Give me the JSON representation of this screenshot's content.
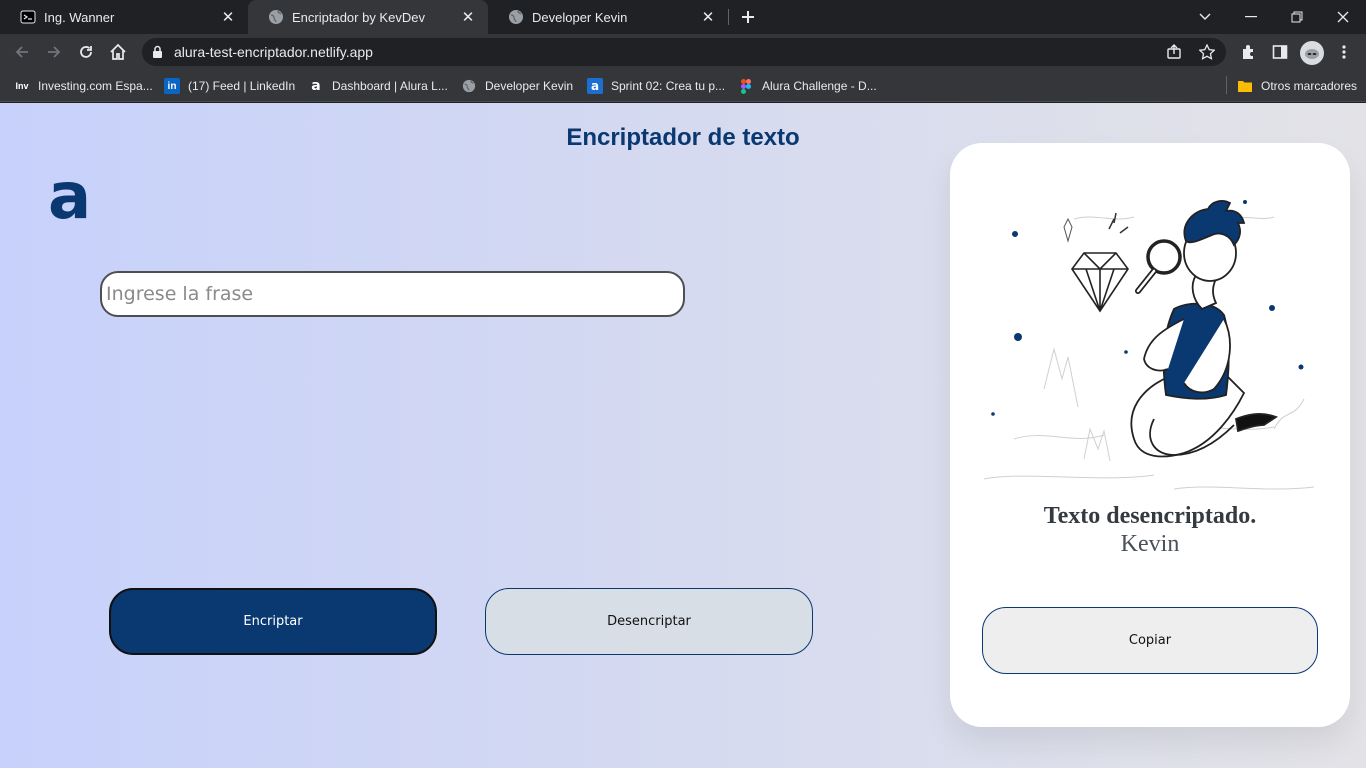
{
  "browser": {
    "tabs": [
      {
        "title": "Ing. Wanner",
        "icon": "terminal-icon"
      },
      {
        "title": "Encriptador by KevDev",
        "icon": "globe-icon",
        "active": true
      },
      {
        "title": "Developer Kevin",
        "icon": "globe-icon"
      }
    ],
    "url": "alura-test-encriptador.netlify.app",
    "bookmarks": [
      {
        "label": "Investing.com Espa...",
        "icon": "inv-icon"
      },
      {
        "label": "(17) Feed | LinkedIn",
        "icon": "linkedin-icon"
      },
      {
        "label": "Dashboard | Alura L...",
        "icon": "alura-icon"
      },
      {
        "label": "Developer Kevin",
        "icon": "globe-icon"
      },
      {
        "label": "Sprint 02: Crea tu p...",
        "icon": "alura-icon"
      },
      {
        "label": "Alura Challenge - D...",
        "icon": "figma-icon"
      }
    ],
    "other_bookmarks": "Otros marcadores"
  },
  "page": {
    "title": "Encriptador de texto",
    "logo": "a",
    "input": {
      "placeholder": "Ingrese la frase",
      "value": ""
    },
    "buttons": {
      "encrypt": "Encriptar",
      "decrypt": "Desencriptar"
    },
    "result": {
      "title": "Texto desencriptado.",
      "text": "Kevin",
      "copy": "Copiar"
    }
  },
  "colors": {
    "accent": "#0a3871",
    "page_bg_left": "#c7d1fb",
    "page_bg_right": "#e3e3e7"
  }
}
